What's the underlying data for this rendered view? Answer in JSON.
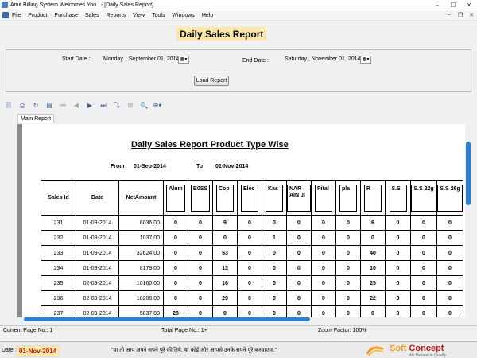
{
  "window": {
    "title": "Amit Billing System Welcomes You.. - [Daily Sales Report]"
  },
  "menu": {
    "items": [
      "File",
      "Product",
      "Purchase",
      "Sales",
      "Reports",
      "View",
      "Tools",
      "Windows",
      "Help"
    ]
  },
  "report_title": "Daily Sales Report",
  "params": {
    "start_label": "Start Date :",
    "start_day": "Monday",
    "start_date": ", September 01, 2014",
    "end_label": "End Date :",
    "end_day": "Saturday",
    "end_date": ", November 01, 2014",
    "load_button": "Load Report"
  },
  "viewer": {
    "tab": "Main Report"
  },
  "report": {
    "heading": "Daily Sales Report Product Type Wise",
    "from_label": "From",
    "from_date": "01-Sep-2014",
    "to_label": "To",
    "to_date": "01-Nov-2014",
    "fixed_headers": [
      "Sales Id",
      "Date",
      "NetAmount"
    ],
    "type_headers": [
      "Alum",
      "B0SS",
      "Cop",
      "Elec",
      "Kas",
      "NAR AIN JI",
      "Pital",
      "pla",
      "R",
      "S.S",
      "S.S 22g",
      "S.S 26g"
    ],
    "rows": [
      {
        "id": "231",
        "date": "01-09-2014",
        "amount": "6036.00",
        "vals": [
          "0",
          "0",
          "9",
          "0",
          "0",
          "0",
          "0",
          "0",
          "6",
          "0",
          "0",
          "0"
        ]
      },
      {
        "id": "232",
        "date": "01-09-2014",
        "amount": "1037.00",
        "vals": [
          "0",
          "0",
          "0",
          "0",
          "1",
          "0",
          "0",
          "0",
          "0",
          "0",
          "0",
          "0"
        ]
      },
      {
        "id": "233",
        "date": "01-09-2014",
        "amount": "32624.00",
        "vals": [
          "0",
          "0",
          "53",
          "0",
          "0",
          "0",
          "0",
          "0",
          "40",
          "0",
          "0",
          "0"
        ]
      },
      {
        "id": "234",
        "date": "01-09-2014",
        "amount": "8179.00",
        "vals": [
          "0",
          "0",
          "13",
          "0",
          "0",
          "0",
          "0",
          "0",
          "10",
          "0",
          "0",
          "0"
        ]
      },
      {
        "id": "235",
        "date": "02-09-2014",
        "amount": "10160.00",
        "vals": [
          "0",
          "0",
          "16",
          "0",
          "0",
          "0",
          "0",
          "0",
          "25",
          "0",
          "0",
          "0"
        ]
      },
      {
        "id": "236",
        "date": "02-09-2014",
        "amount": "18208.00",
        "vals": [
          "0",
          "0",
          "29",
          "0",
          "0",
          "0",
          "0",
          "0",
          "22",
          "3",
          "0",
          "0"
        ]
      },
      {
        "id": "237",
        "date": "02-09-2014",
        "amount": "5837.00",
        "vals": [
          "28",
          "0",
          "0",
          "0",
          "0",
          "0",
          "0",
          "0",
          "0",
          "0",
          "0",
          "0"
        ]
      }
    ]
  },
  "status": {
    "current_page": "Current Page No.: 1",
    "total_page": "Total Page No.: 1+",
    "zoom": "Zoom Factor: 100%"
  },
  "footer": {
    "date_label": "Date :",
    "date_value": "01-Nov-2014",
    "quote": "\"या तो आप अपने सपने पूरे कीजिये, या कोई और आपसे उनके सपने पूरे करवाएगा.\"",
    "logo_name": "Soft Concept",
    "logo_tag": "We Believe in Quality"
  },
  "colors": {
    "accent": "#2e7fd0",
    "title_bg": "#fde6a8",
    "date_red": "#c01818"
  }
}
